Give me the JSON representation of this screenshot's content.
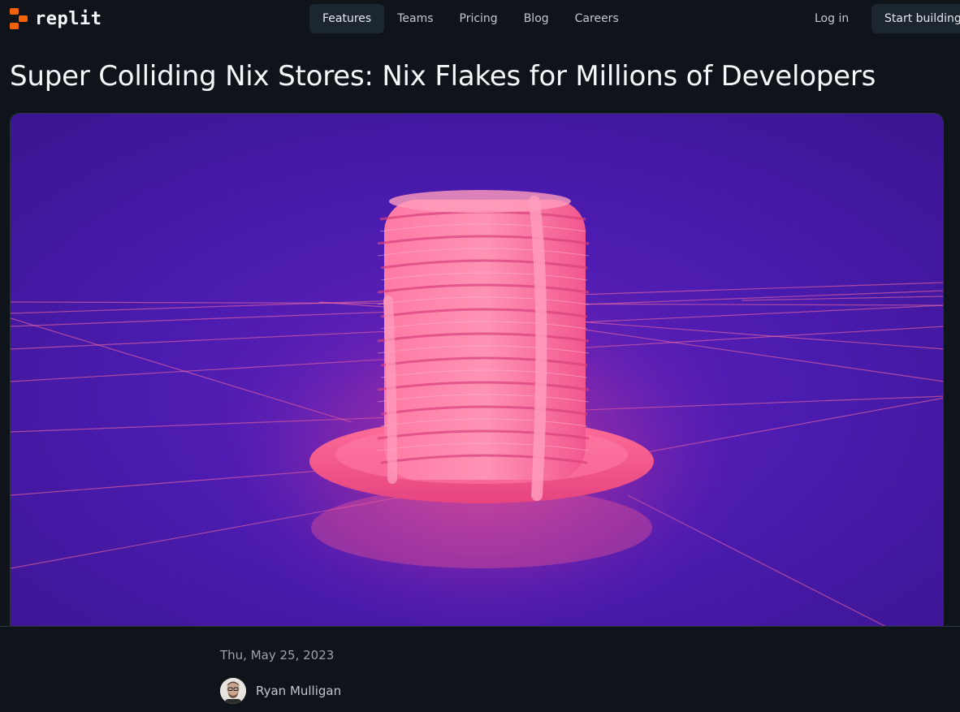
{
  "brand": {
    "name": "replit",
    "accent": "#f26207"
  },
  "nav": {
    "items": [
      {
        "label": "Features",
        "active": true
      },
      {
        "label": "Teams",
        "active": false
      },
      {
        "label": "Pricing",
        "active": false
      },
      {
        "label": "Blog",
        "active": false
      },
      {
        "label": "Careers",
        "active": false
      }
    ],
    "login_label": "Log in",
    "cta_label": "Start building"
  },
  "article": {
    "title": "Super Colliding Nix Stores: Nix Flakes for Millions of Developers",
    "date": "Thu, May 25, 2023",
    "author": "Ryan Mulligan"
  },
  "colors": {
    "background": "#0e1419",
    "hero_purple": "#4c1bb0",
    "hero_pink": "#ff5d8f"
  }
}
